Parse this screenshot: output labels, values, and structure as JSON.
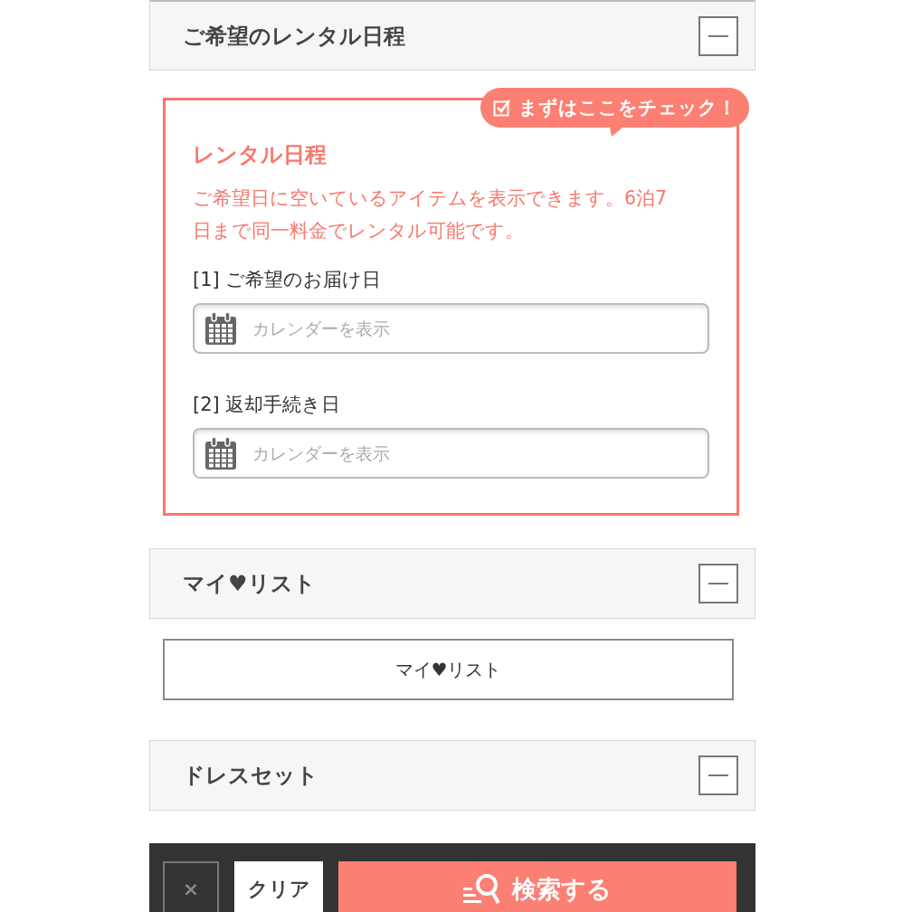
{
  "sections": [
    {
      "kind": "schedule",
      "title": "ご希望のレンタル日程",
      "expanded": true,
      "badge": "まずはここをチェック！",
      "heading": "レンタル日程",
      "description": "ご希望日に空いているアイテムを表示できます。6泊7日まで同一料金でレンタル可能です。",
      "fields": [
        {
          "label": "[1] ご希望のお届け日",
          "placeholder": "カレンダーを表示"
        },
        {
          "label": "[2] 返却手続き日",
          "placeholder": "カレンダーを表示"
        }
      ]
    },
    {
      "kind": "link",
      "title": "マイ♥リスト",
      "expanded": true,
      "button": "マイ♥リスト"
    },
    {
      "kind": "empty",
      "title": "ドレスセット",
      "expanded": true
    }
  ],
  "footer": {
    "close": "×",
    "clear": "クリア",
    "search": "検索する"
  }
}
